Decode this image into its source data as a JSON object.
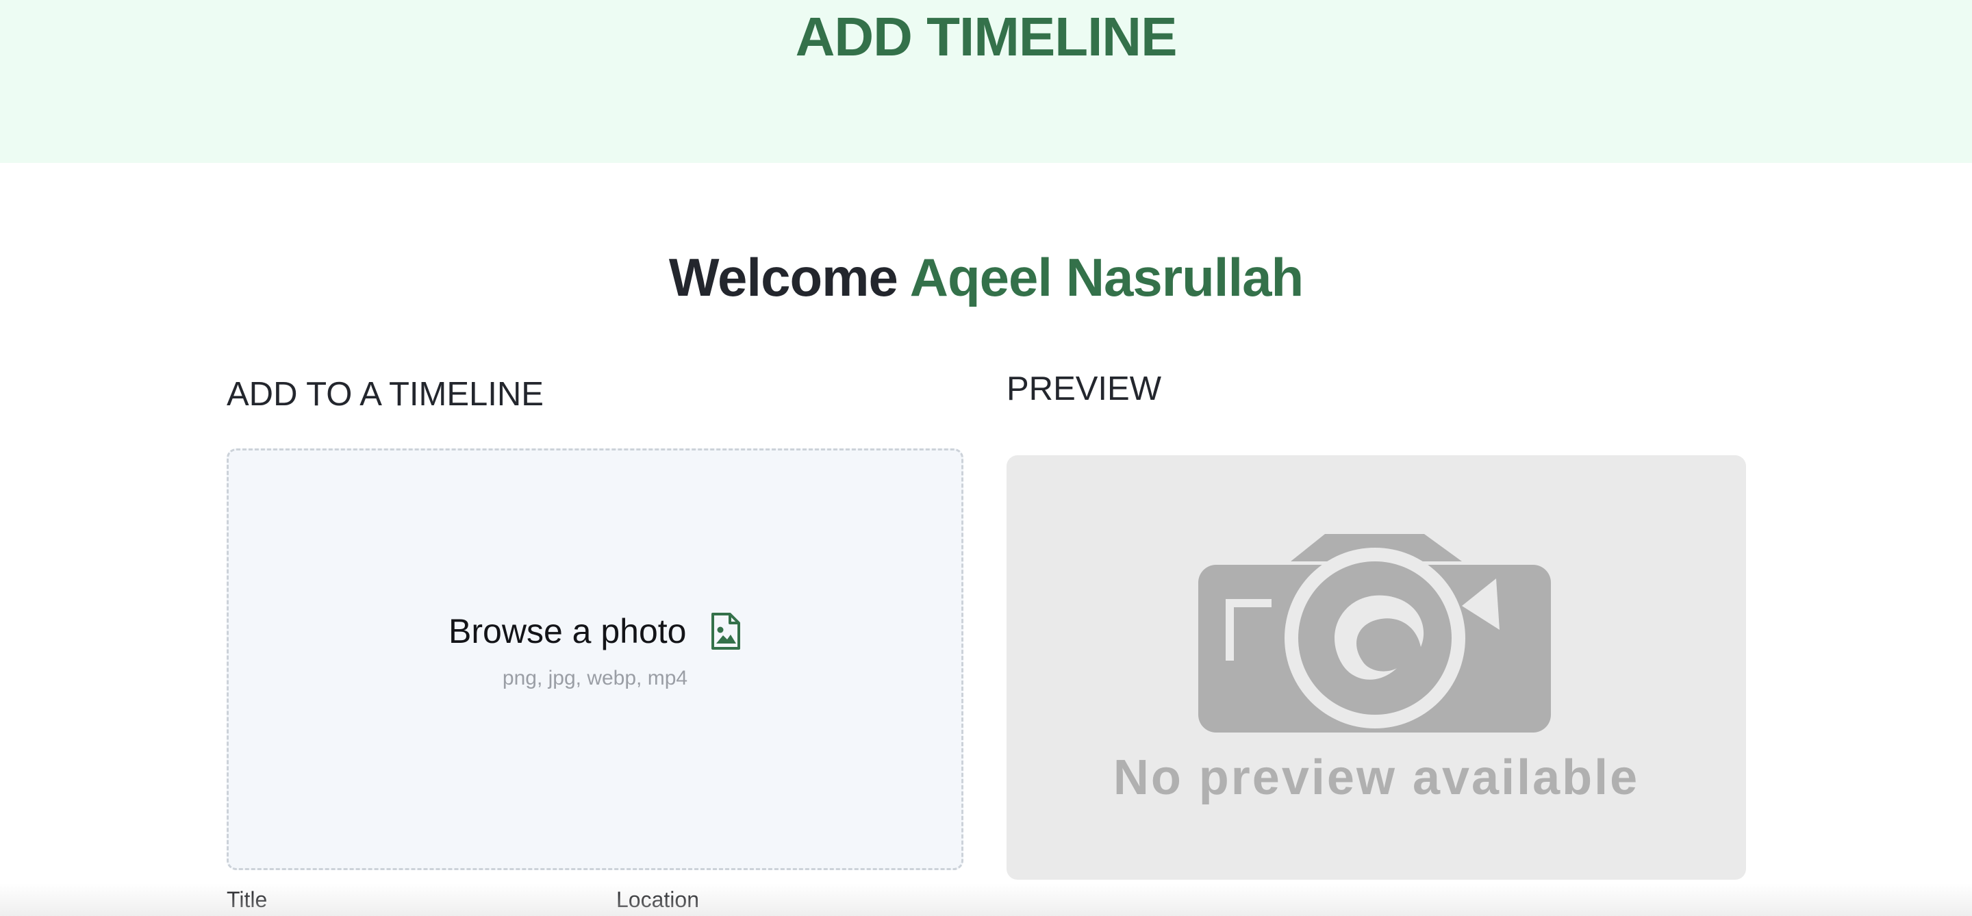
{
  "header": {
    "title": "ADD TIMELINE"
  },
  "welcome": {
    "greeting": "Welcome",
    "user_name": "Aqeel Nasrullah"
  },
  "upload_section": {
    "heading": "ADD TO A TIMELINE",
    "browse_label": "Browse a photo",
    "formats": "png, jpg, webp, mp4",
    "icon": "image-file-icon"
  },
  "preview_section": {
    "heading": "PREVIEW",
    "placeholder_text": "No preview available",
    "icon": "camera-icon"
  },
  "form": {
    "title_label": "Title",
    "location_label": "Location"
  },
  "colors": {
    "brand_green": "#34714a",
    "hero_background": "#edfcf3",
    "dropzone_background": "#f4f7fb",
    "preview_background": "#eaeaea"
  }
}
